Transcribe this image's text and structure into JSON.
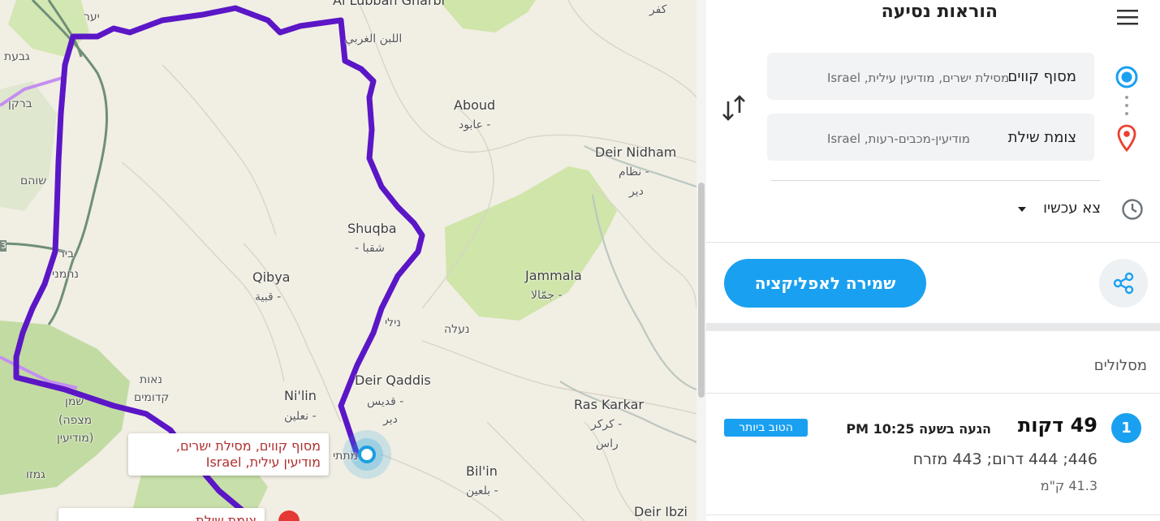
{
  "map": {
    "places": [
      {
        "name": "Al Lubban al Gharbi",
        "label_en": "Al Lubban Gharbi"
      },
      {
        "name": "Al Lubban arabic",
        "label": "اللبن الغربي"
      },
      {
        "name": "Kafr",
        "label": "كفر"
      },
      {
        "name": "Aboud",
        "label": "Aboud"
      },
      {
        "name": "Aboud arabic",
        "label": "عابود -"
      },
      {
        "name": "Deir Nidham",
        "label": "Deir Nidham"
      },
      {
        "name": "Deir Nidham arabic",
        "label": "نظام -"
      },
      {
        "name": "Deir Nidham arabic 2",
        "label": "دير"
      },
      {
        "name": "Shuqba",
        "label": "Shuqba"
      },
      {
        "name": "Shuqba arabic",
        "label": "- شقبا"
      },
      {
        "name": "Qibya",
        "label": "Qibya"
      },
      {
        "name": "Qibya arabic",
        "label": "قبية -"
      },
      {
        "name": "Jammala",
        "label": "Jammala"
      },
      {
        "name": "Jammala arabic",
        "label": "جمّالا -"
      },
      {
        "name": "Nili",
        "label": "נילי"
      },
      {
        "name": "Naale",
        "label": "נעלה"
      },
      {
        "name": "Deir Qaddis",
        "label": "Deir Qaddis"
      },
      {
        "name": "Deir Qaddis arabic",
        "label": "قديس -"
      },
      {
        "name": "Deir Qaddis arabic 2",
        "label": "دير"
      },
      {
        "name": "Nilin",
        "label": "Ni'lin"
      },
      {
        "name": "Nilin arabic",
        "label": "نعلين -"
      },
      {
        "name": "Ras Karkar",
        "label": "Ras Karkar"
      },
      {
        "name": "Ras Karkar arabic",
        "label": "كركر -"
      },
      {
        "name": "Ras Karkar arabic 2",
        "label": "راس"
      },
      {
        "name": "Bilin",
        "label": "Bil'in"
      },
      {
        "name": "Bilin arabic",
        "label": "بلعين -"
      },
      {
        "name": "Deir Ibzi",
        "label": "Deir Ibzi"
      },
      {
        "name": "Yaar",
        "label": "יער"
      },
      {
        "name": "Givat",
        "label": "גבעת"
      },
      {
        "name": "Barkan",
        "label": "ברקן"
      },
      {
        "name": "Shoham",
        "label": "שוהם"
      },
      {
        "name": "Bira",
        "label": "ביר"
      },
      {
        "name": "Nachmani",
        "label": "נחמני"
      },
      {
        "name": "Naot",
        "label": "נאות"
      },
      {
        "name": "Kdumim",
        "label": "קדומים"
      },
      {
        "name": "Shemen",
        "label": "שמן"
      },
      {
        "name": "Mitzpe",
        "label": "(מצפה"
      },
      {
        "name": "Modiin",
        "label": "מודיעין)"
      },
      {
        "name": "Gimzo",
        "label": "גמזו"
      },
      {
        "name": "Matityahu",
        "label": "מתתי"
      },
      {
        "name": "Road 3",
        "label": "3"
      }
    ],
    "origin_callout": {
      "line1": "מסוף קווים, מסילת ישרים,",
      "line2": "מודיעין עילית, Israel"
    },
    "dest_callout": {
      "line1": "צומת שילת"
    },
    "colors": {
      "route": "#5b16c6",
      "alt_route": "#c48ff0",
      "green": "#cfe5a9",
      "origin": "#1a9fe0"
    }
  },
  "panel": {
    "title": "הוראות נסיעה",
    "origin": {
      "main": "מסוף קווים",
      "sub": "מסילת ישרים, מודיעין עילית, Israel"
    },
    "destination": {
      "main": "צומת שילת",
      "sub": "מודיעין-מכבים-רעות, Israel"
    },
    "leave": "צא עכשיו",
    "save_button": "שמירה לאפליקציה",
    "routes_title": "מסלולים",
    "route": {
      "number": "1",
      "duration": "49 דקות",
      "arrival": "הגעה בשעה 10:25 PM",
      "badge": "הטוב ביותר",
      "roads": "446; 444 דרום; 443 מזרח",
      "distance": "41.3 ק\"מ"
    },
    "icons": {
      "menu": "menu-icon",
      "swap": "swap-icon",
      "origin": "origin-icon",
      "destination": "destination-pin-icon",
      "clock": "clock-icon",
      "share": "share-icon"
    },
    "accent": "#1aa0f0"
  }
}
